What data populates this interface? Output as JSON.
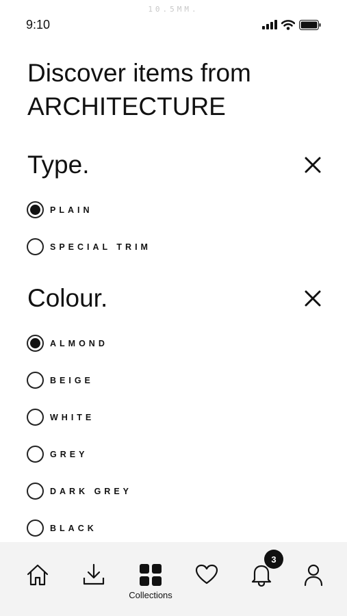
{
  "brand_mark": "10.5MM.",
  "status_bar": {
    "time": "9:10"
  },
  "title": {
    "line1": "Discover items from",
    "line2": "ARCHITECTURE"
  },
  "sections": {
    "type": {
      "title": "Type.",
      "options": [
        {
          "label": "PLAIN",
          "selected": true
        },
        {
          "label": "SPECIAL TRIM",
          "selected": false
        }
      ]
    },
    "colour": {
      "title": "Colour.",
      "options": [
        {
          "label": "ALMOND",
          "selected": true
        },
        {
          "label": "BEIGE",
          "selected": false
        },
        {
          "label": "WHITE",
          "selected": false
        },
        {
          "label": "GREY",
          "selected": false
        },
        {
          "label": "DARK GREY",
          "selected": false
        },
        {
          "label": "BLACK",
          "selected": false
        }
      ]
    }
  },
  "bottom_nav": {
    "items": [
      {
        "icon": "home-icon",
        "label": ""
      },
      {
        "icon": "download-icon",
        "label": ""
      },
      {
        "icon": "grid-icon",
        "label": "Collections",
        "active": true
      },
      {
        "icon": "heart-icon",
        "label": ""
      },
      {
        "icon": "bell-icon",
        "label": "",
        "badge": "3"
      },
      {
        "icon": "user-icon",
        "label": ""
      }
    ]
  },
  "colors": {
    "text": "#111111",
    "nav_background": "#f3f3f3",
    "badge": "#111111",
    "brand_mark": "#c8c8c8"
  }
}
